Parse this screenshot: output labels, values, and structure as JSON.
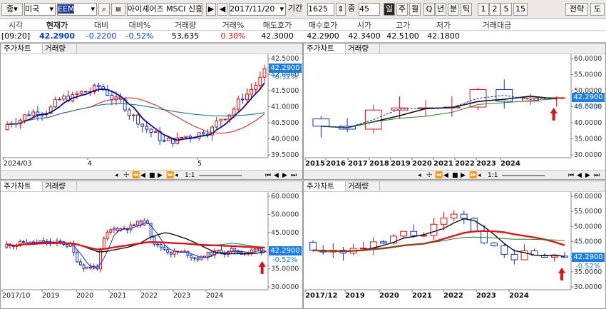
{
  "toolbar": {
    "exchange_label": "종",
    "market": "미국",
    "symbol": "EEM",
    "instrument_name": "아이셰어즈 MSCI 신흥",
    "date": "2017/11/20",
    "period_label": "기간",
    "period_value": "1625",
    "count_label": "중",
    "count_value": "45",
    "tabs": [
      "일",
      "주",
      "월",
      "Q",
      "년",
      "분",
      "틱",
      "1",
      "2",
      "5",
      "15"
    ],
    "active_tab": "일",
    "strategy_label": "전략",
    "tool_label": "도"
  },
  "quote": {
    "headers": [
      "시각",
      "현재가",
      "대비",
      "대비%",
      "거래량",
      "거래%",
      "매도호가",
      "매수호가",
      "시가",
      "고가",
      "저가",
      "거래대금"
    ],
    "values": [
      "[09:20]",
      "42.2900",
      "-0.2200",
      "-0.52%",
      "53,635",
      "0.30%",
      "42.3000",
      "42.2900",
      "42.3400",
      "42.5100",
      "42.1800",
      ""
    ]
  },
  "panes": {
    "tab_chart": "주가차트",
    "tab_volume": "거래량",
    "top_left": {
      "price_label": "42.2900",
      "pct_label": "-0.52%",
      "y_ticks": [
        "42.5000",
        "42.0000",
        "41.5000",
        "41.0000",
        "40.5000",
        "40.0000",
        "39.5000"
      ],
      "x_labels": [
        "2024/03",
        "4",
        "5"
      ]
    },
    "top_right": {
      "price_label": "42.2900",
      "pct_label": "-0.52%",
      "y_ticks": [
        "60.0000",
        "55.0000",
        "50.0000",
        "45.0000",
        "40.0000",
        "35.0000",
        "30.0000"
      ],
      "x_labels": [
        "2015",
        "2016",
        "2017",
        "2018",
        "2019",
        "2020",
        "2021",
        "2022",
        "2023",
        "2024"
      ]
    },
    "bottom_left": {
      "price_label": "42.2900",
      "pct_label": "-0.52%",
      "y_ticks": [
        "60.0000",
        "50.0000",
        "45.0000",
        "40.0000",
        "35.0000",
        "30.0000"
      ],
      "x_labels": [
        "2017/10",
        "2019",
        "2020",
        "2021",
        "2022",
        "2023",
        "2024"
      ]
    },
    "bottom_right": {
      "price_label": "42.2900",
      "pct_label": "-0.52%",
      "y_ticks": [
        "60.0000",
        "55.0000",
        "50.0000",
        "45.0000",
        "40.0000",
        "35.0000",
        "30.0000"
      ],
      "x_labels": [
        "2017/12",
        "2019",
        "2020",
        "2021",
        "2022",
        "2023",
        "2024"
      ]
    },
    "zoom_label": "1:1"
  },
  "colors": {
    "up": "#d01010",
    "down": "#1030c0",
    "ma5": "#0a0a8a",
    "ma20": "#d81818",
    "ma60": "#2a7a2a",
    "ma120": "#1c6fd6",
    "price_badge": "#1f7fe0"
  }
}
